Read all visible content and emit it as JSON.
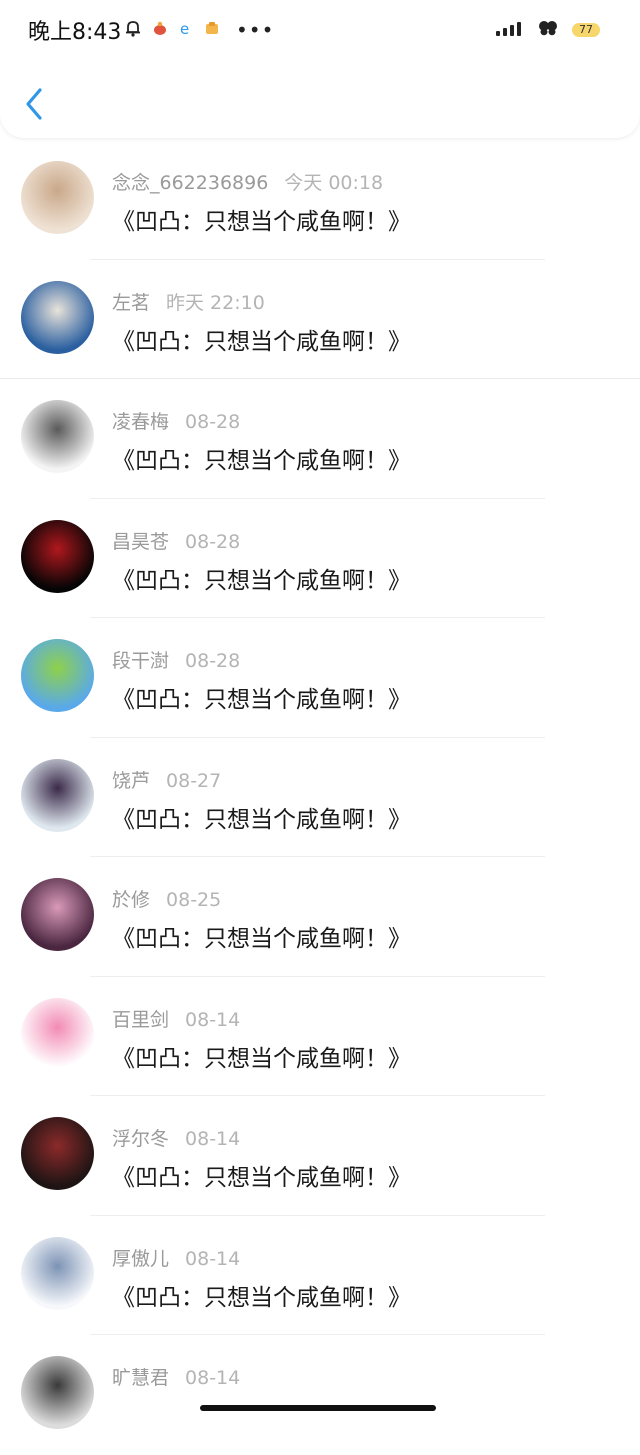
{
  "status_bar": {
    "time": "晚上8:43",
    "battery": "77",
    "left_icons": [
      "alarm-bell-icon",
      "app-notification-icon",
      "browser-icon",
      "folder-icon"
    ],
    "more": "•••",
    "right_icons": [
      "signal-icon",
      "butterfly-icon",
      "battery-icon"
    ]
  },
  "header": {
    "back_icon": "chevron-left-icon"
  },
  "items": [
    {
      "name": "念念_662236896",
      "time": "今天 00:18",
      "message": "《凹凸：只想当个咸鱼啊！》",
      "avatar_colors": [
        "#efe2d4",
        "#c9a88a"
      ]
    },
    {
      "name": "左茗",
      "time": "昨天 22:10",
      "message": "《凹凸：只想当个咸鱼啊！》",
      "avatar_colors": [
        "#2a5fa0",
        "#e9e3da"
      ]
    },
    {
      "name": "凌春梅",
      "time": "08-28",
      "message": "《凹凸：只想当个咸鱼啊！》",
      "avatar_colors": [
        "#f4f4f4",
        "#5a5a5a"
      ]
    },
    {
      "name": "昌昊苍",
      "time": "08-28",
      "message": "《凹凸：只想当个咸鱼啊！》",
      "avatar_colors": [
        "#050505",
        "#b0181e"
      ]
    },
    {
      "name": "段干澍",
      "time": "08-28",
      "message": "《凹凸：只想当个咸鱼啊！》",
      "avatar_colors": [
        "#59a9ea",
        "#8fd14a"
      ]
    },
    {
      "name": "饶芦",
      "time": "08-27",
      "message": "《凹凸：只想当个咸鱼啊！》",
      "avatar_colors": [
        "#dfe8ef",
        "#3b2a4a"
      ]
    },
    {
      "name": "於修",
      "time": "08-25",
      "message": "《凹凸：只想当个咸鱼啊！》",
      "avatar_colors": [
        "#4a2640",
        "#d99ab8"
      ]
    },
    {
      "name": "百里剑",
      "time": "08-14",
      "message": "《凹凸：只想当个咸鱼啊！》",
      "avatar_colors": [
        "#ffffff",
        "#f28bb4"
      ]
    },
    {
      "name": "浮尔冬",
      "time": "08-14",
      "message": "《凹凸：只想当个咸鱼啊！》",
      "avatar_colors": [
        "#1e1414",
        "#8c2a2a"
      ]
    },
    {
      "name": "厚傲儿",
      "time": "08-14",
      "message": "《凹凸：只想当个咸鱼啊！》",
      "avatar_colors": [
        "#f6f8fb",
        "#7d93b5"
      ]
    },
    {
      "name": "旷慧君",
      "time": "08-14",
      "message": "",
      "avatar_colors": [
        "#dcdcdc",
        "#3a3a3a"
      ]
    }
  ]
}
